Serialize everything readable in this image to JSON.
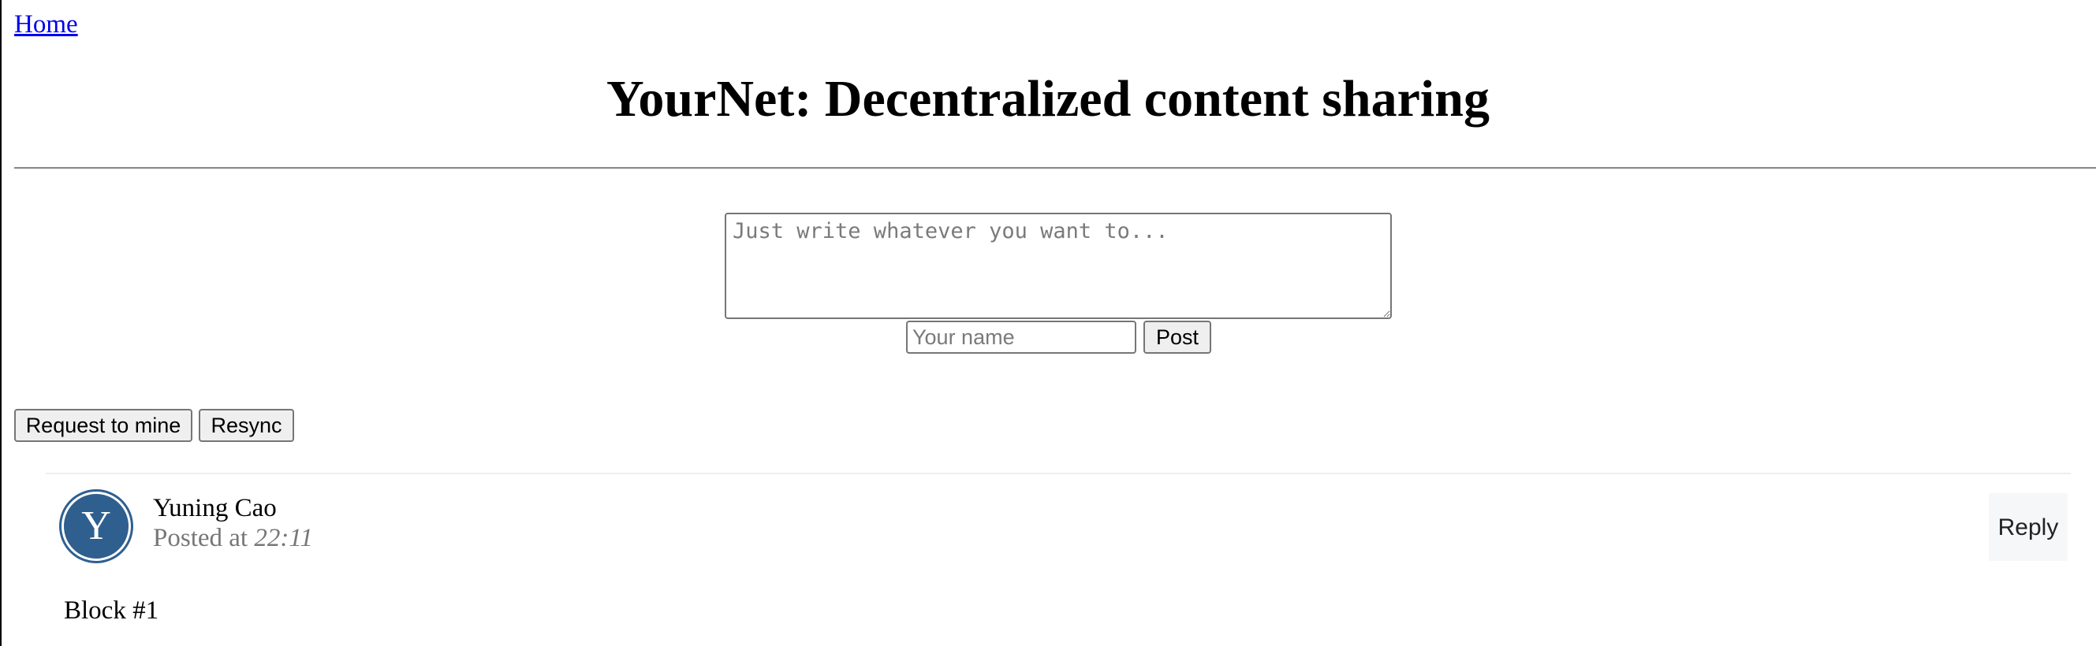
{
  "nav": {
    "home_label": "Home"
  },
  "header": {
    "title": "YourNet: Decentralized content sharing"
  },
  "compose": {
    "textarea_placeholder": "Just write whatever you want to...",
    "name_placeholder": "Your name",
    "post_label": "Post"
  },
  "actions": {
    "mine_label": "Request to mine",
    "resync_label": "Resync"
  },
  "feed": {
    "posts": [
      {
        "avatar_letter": "Y",
        "avatar_color": "#2f5f8f",
        "author": "Yuning Cao",
        "posted_prefix": "Posted at ",
        "time": "22:11",
        "reply_label": "Reply",
        "content": "Block #1"
      }
    ]
  }
}
